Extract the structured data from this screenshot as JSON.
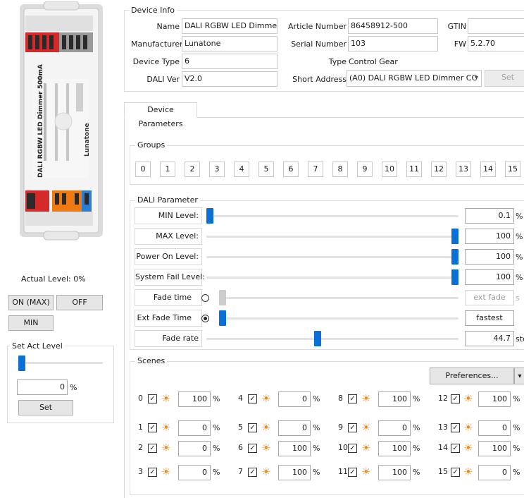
{
  "device_info": {
    "legend": "Device Info",
    "name_label": "Name",
    "name_value": "DALI RGBW LED Dimme...",
    "manufacturer_label": "Manufacturer",
    "manufacturer_value": "Lunatone",
    "device_type_label": "Device Type",
    "device_type_value": "6",
    "dali_ver_label": "DALI Ver",
    "dali_ver_value": "V2.0",
    "article_label": "Article Number",
    "article_value": "86458912-500",
    "serial_label": "Serial Number",
    "serial_value": "103",
    "type_label": "Type",
    "type_value": "Control Gear",
    "short_address_label": "Short Address",
    "short_address_value": "(A0) DALI RGBW LED Dimmer CC",
    "gtin_label": "GTIN",
    "gtin_value": "",
    "fw_label": "FW",
    "fw_value": "5.2.70",
    "set_label": "Set"
  },
  "device_image": {
    "product_text": "DALI RGBW LED Dimmer 500mA",
    "brand": "Lunatone"
  },
  "tabs": [
    "Device Parameters"
  ],
  "groups": {
    "legend": "Groups",
    "items": [
      "0",
      "1",
      "2",
      "3",
      "4",
      "5",
      "6",
      "7",
      "8",
      "9",
      "10",
      "11",
      "12",
      "13",
      "14",
      "15"
    ]
  },
  "dali_parameter": {
    "legend": "DALI Parameter",
    "rows": [
      {
        "label": "MIN Level:",
        "value": "0.1",
        "unit": "%",
        "level": 0.001
      },
      {
        "label": "MAX Level:",
        "value": "100",
        "unit": "%",
        "level": 1.0
      },
      {
        "label": "Power On Level:",
        "value": "100",
        "unit": "%",
        "level": 1.0
      },
      {
        "label": "System Fail Level:",
        "value": "100",
        "unit": "%",
        "level": 1.0
      },
      {
        "label": "Fade time",
        "value": "ext fade",
        "unit": "s",
        "level": 0.0
      },
      {
        "label": "Ext Fade Time",
        "value": "fastest",
        "unit": "",
        "level": 0.0
      },
      {
        "label": "Fade rate",
        "value": "44.7",
        "unit": "step/s",
        "level": 0.44
      }
    ]
  },
  "scenes": {
    "legend": "Scenes",
    "preferences_label": "Preferences...",
    "dropdown_glyph": "▾",
    "check_glyph": "✓",
    "sun_glyph": "☀",
    "items": [
      {
        "index": "0",
        "value": "100",
        "unit": "%"
      },
      {
        "index": "1",
        "value": "0",
        "unit": "%"
      },
      {
        "index": "2",
        "value": "0",
        "unit": "%"
      },
      {
        "index": "3",
        "value": "0",
        "unit": "%"
      },
      {
        "index": "4",
        "value": "0",
        "unit": "%"
      },
      {
        "index": "5",
        "value": "0",
        "unit": "%"
      },
      {
        "index": "6",
        "value": "100",
        "unit": "%"
      },
      {
        "index": "7",
        "value": "100",
        "unit": "%"
      },
      {
        "index": "8",
        "value": "100",
        "unit": "%"
      },
      {
        "index": "9",
        "value": "0",
        "unit": "%"
      },
      {
        "index": "10",
        "value": "100",
        "unit": "%"
      },
      {
        "index": "11",
        "value": "100",
        "unit": "%"
      },
      {
        "index": "12",
        "value": "100",
        "unit": "%"
      },
      {
        "index": "13",
        "value": "0",
        "unit": "%"
      },
      {
        "index": "14",
        "value": "100",
        "unit": "%"
      },
      {
        "index": "15",
        "value": "0",
        "unit": "%"
      }
    ]
  },
  "left_panel": {
    "actual_level_text": "Actual Level: 0%",
    "on_max_label": "ON (MAX)",
    "off_label": "OFF",
    "min_label": "MIN",
    "set_act_level_legend": "Set Act Level",
    "act_level_value": "0",
    "act_level_unit": "%",
    "act_level_fraction": 0.0,
    "set_label": "Set"
  },
  "colors": {
    "accent": "#0a6fd6",
    "sun": "#f08a1e",
    "terminal_red": "#d42a2a",
    "terminal_orange": "#f07a12",
    "terminal_blue": "#2a7fd4"
  }
}
